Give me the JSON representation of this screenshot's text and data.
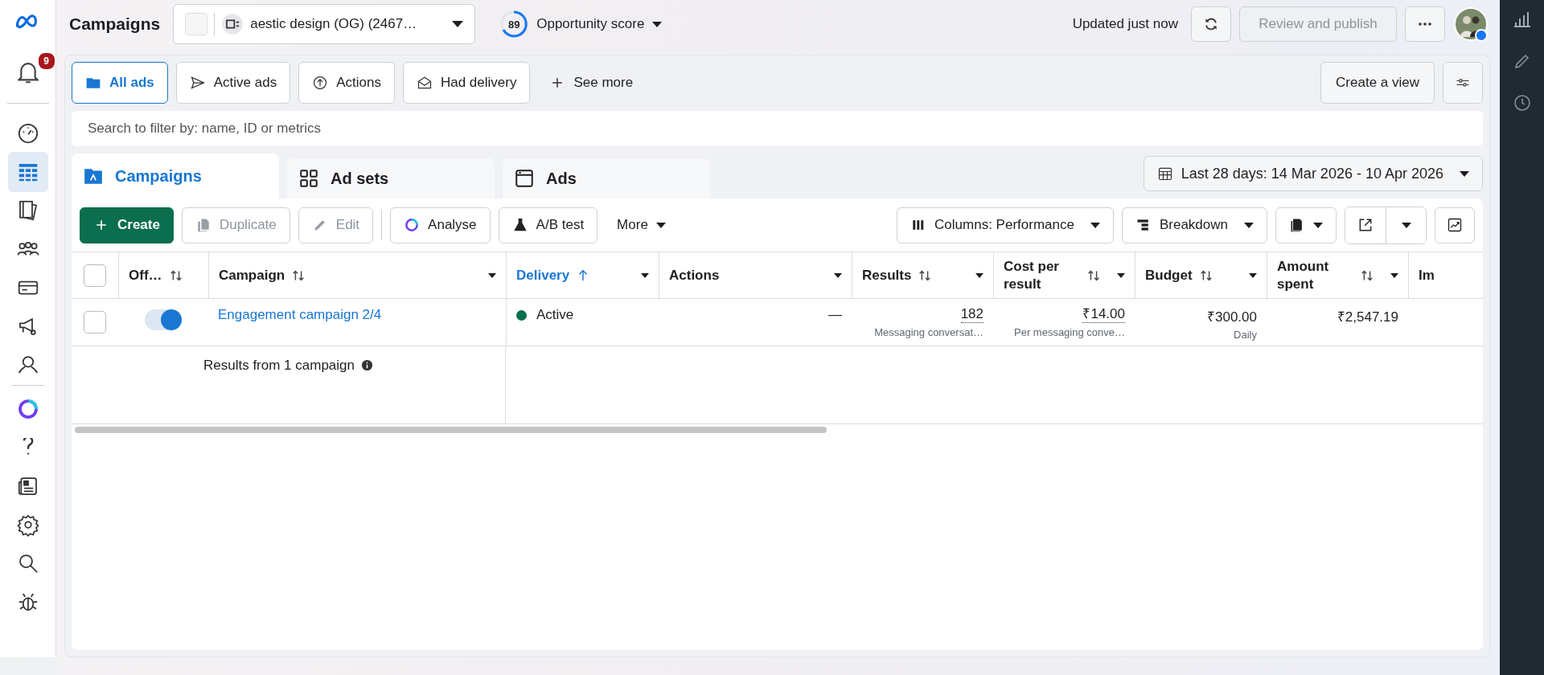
{
  "nav": {
    "notifications": "9",
    "items": [
      {
        "kind": "gauge",
        "selected": false
      },
      {
        "kind": "table",
        "selected": true
      },
      {
        "kind": "pages",
        "selected": false
      },
      {
        "kind": "people",
        "selected": false
      },
      {
        "kind": "card",
        "selected": false
      },
      {
        "kind": "megaphone",
        "selected": false
      },
      {
        "kind": "person",
        "selected": false
      },
      {
        "kind": "ring",
        "selected": false
      },
      {
        "kind": "help",
        "selected": false
      },
      {
        "kind": "news",
        "selected": false
      },
      {
        "kind": "settings",
        "selected": false
      },
      {
        "kind": "search",
        "selected": false
      },
      {
        "kind": "bug",
        "selected": false
      }
    ]
  },
  "header": {
    "title": "Campaigns",
    "account": "aestic design (OG) (2467…",
    "score": "89",
    "score_label": "Opportunity score",
    "updated": "Updated just now",
    "review": {
      "label": "Review and publish",
      "disabled": true
    }
  },
  "filters": [
    {
      "label": "All ads",
      "kind": "folder",
      "selected": true
    },
    {
      "label": "Active ads",
      "kind": "send",
      "selected": false
    },
    {
      "label": "Actions",
      "kind": "upload",
      "selected": false
    },
    {
      "label": "Had delivery",
      "kind": "mail",
      "selected": false
    }
  ],
  "see_more": "See more",
  "create_view": "Create a view",
  "search": {
    "placeholder": "Search to filter by: name, ID or metrics"
  },
  "level_tabs": [
    {
      "label": "Campaigns",
      "kind": "folder",
      "selected": true
    },
    {
      "label": "Ad sets",
      "kind": "grid",
      "selected": false
    },
    {
      "label": "Ads",
      "kind": "window",
      "selected": false
    }
  ],
  "date_range": "Last 28 days: 14 Mar 2026 - 10 Apr 2026",
  "actions": [
    {
      "label": "Create",
      "kind": "plus",
      "primary": true,
      "disabled": false
    },
    {
      "label": "Duplicate",
      "kind": "copy",
      "primary": false,
      "disabled": true
    },
    {
      "label": "Edit",
      "kind": "pencil",
      "primary": false,
      "disabled": true
    },
    {
      "label": "Analyse",
      "kind": "ring",
      "primary": false,
      "disabled": false
    },
    {
      "label": "A/B test",
      "kind": "flask",
      "primary": false,
      "disabled": false
    }
  ],
  "more": "More",
  "columns_button": "Columns: Performance",
  "breakdown_button": "Breakdown",
  "table": {
    "all_selected": false,
    "columns": [
      {
        "label": "Off…",
        "sortable": true,
        "ascending": false,
        "menu": false,
        "active": false
      },
      {
        "label": "Campaign",
        "sortable": true,
        "ascending": false,
        "menu": true,
        "active": false
      },
      {
        "label": "Delivery",
        "sortable": true,
        "ascending": true,
        "menu": true,
        "active": true
      },
      {
        "label": "Actions",
        "sortable": false,
        "menu": true,
        "active": false
      },
      {
        "label": "Results",
        "sortable": true,
        "ascending": false,
        "menu": true,
        "active": false
      },
      {
        "label": "Cost per result",
        "sortable": true,
        "ascending": false,
        "menu": true,
        "active": false
      },
      {
        "label": "Budget",
        "sortable": true,
        "ascending": false,
        "menu": true,
        "active": false
      },
      {
        "label": "Amount spent",
        "sortable": true,
        "ascending": false,
        "menu": true,
        "active": false
      },
      {
        "label": "Im",
        "sortable": false,
        "menu": false,
        "active": false
      }
    ],
    "rows": [
      {
        "selected": false,
        "on": true,
        "campaign": "Engagement campaign 2/4",
        "delivery": "Active",
        "color": "#0b6e4f",
        "actions": "—",
        "results": "182",
        "results_sub": "Messaging conversat…",
        "cost": "₹14.00",
        "cost_sub": "Per messaging conve…",
        "budget": "₹300.00",
        "budget_sub": "Daily",
        "amount": "₹2,547.19"
      }
    ],
    "summary": "Results from 1 campaign"
  }
}
